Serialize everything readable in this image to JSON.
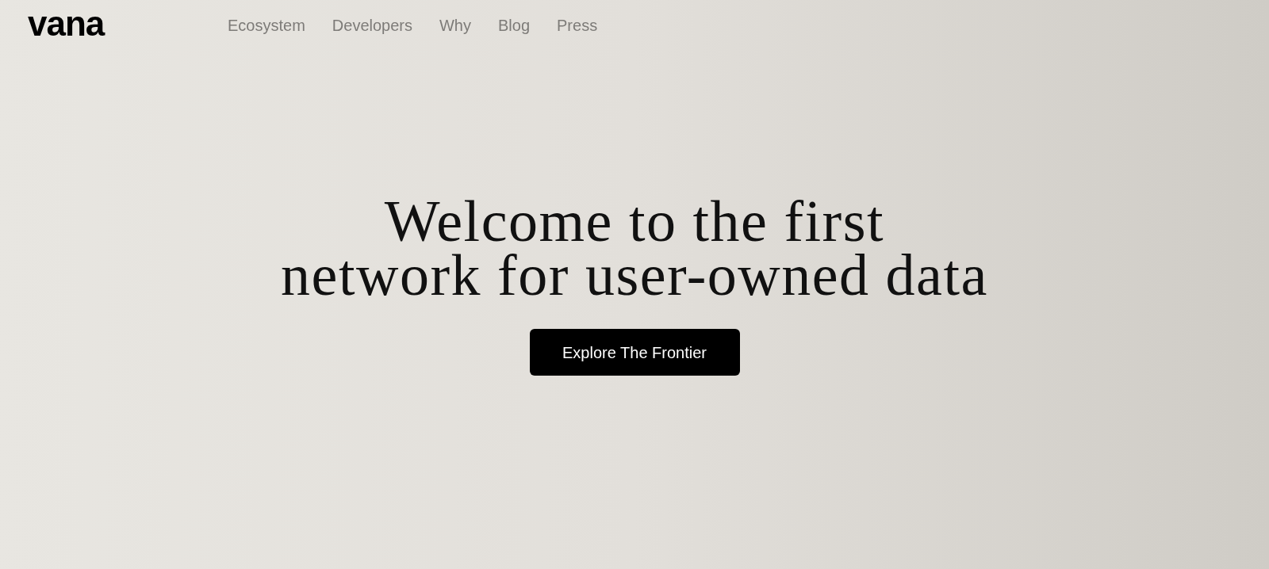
{
  "logo": {
    "text": "vana"
  },
  "nav": [
    {
      "label": "Ecosystem"
    },
    {
      "label": "Developers"
    },
    {
      "label": "Why"
    },
    {
      "label": "Blog"
    },
    {
      "label": "Press"
    }
  ],
  "hero": {
    "heading_lines": [
      "Welcome to the first",
      "network for user-owned data"
    ],
    "button": "Explore The Frontier"
  }
}
